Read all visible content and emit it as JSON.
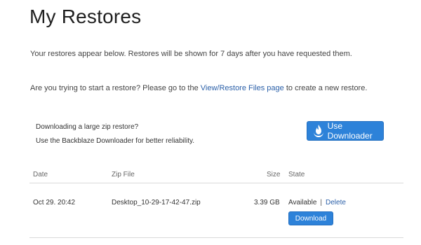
{
  "page": {
    "title": "My Restores",
    "intro_text": "Your restores appear below. Restores will be shown for 7 days after you have requested them.",
    "hint_prefix": "Are you trying to start a restore? Please go to the ",
    "hint_link": "View/Restore Files page",
    "hint_suffix": " to create a new restore."
  },
  "downloader": {
    "line1": "Downloading a large zip restore?",
    "line2": "Use the Backblaze Downloader for better reliability.",
    "button_label": "Use Downloader",
    "button_icon": "backblaze-flame-icon",
    "button_color": "#2d82d9"
  },
  "table": {
    "headers": {
      "date": "Date",
      "zip_file": "Zip File",
      "size": "Size",
      "state": "State"
    },
    "rows": [
      {
        "date": "Oct 29. 20:42",
        "zip_file": "Desktop_10-29-17-42-47.zip",
        "size": "3.39 GB",
        "state": "Available",
        "separator": "|",
        "delete_label": "Delete",
        "download_label": "Download"
      }
    ]
  }
}
